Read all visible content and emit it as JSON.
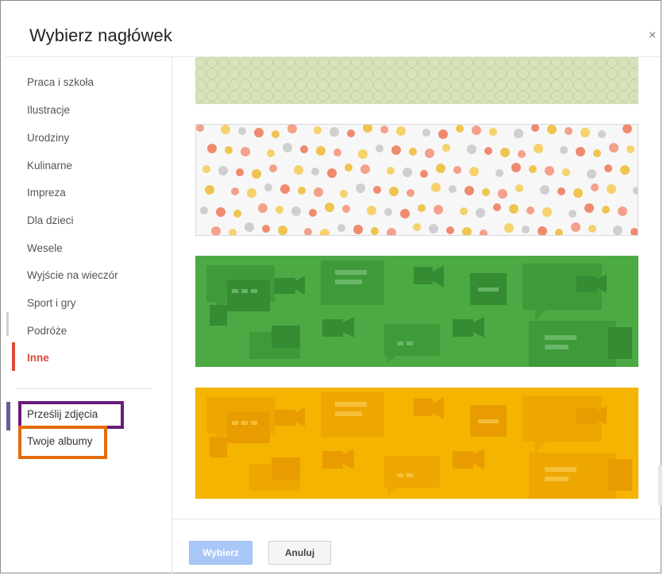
{
  "dialog": {
    "title": "Wybierz nagłówek",
    "close_label": "×"
  },
  "sidebar": {
    "categories": [
      {
        "label": "Praca i szkoła"
      },
      {
        "label": "Ilustracje"
      },
      {
        "label": "Urodziny"
      },
      {
        "label": "Kulinarne"
      },
      {
        "label": "Impreza"
      },
      {
        "label": "Dla dzieci"
      },
      {
        "label": "Wesele"
      },
      {
        "label": "Wyjście na wieczór"
      },
      {
        "label": "Sport i gry"
      },
      {
        "label": "Podróże"
      },
      {
        "label": "Inne"
      }
    ],
    "active_category": "Inne",
    "links": [
      {
        "label": "Prześlij zdjęcia"
      },
      {
        "label": "Twoje albumy"
      }
    ]
  },
  "banners": [
    {
      "name": "geometric-green"
    },
    {
      "name": "polka-dots"
    },
    {
      "name": "chat-icons-green"
    },
    {
      "name": "chat-icons-yellow"
    }
  ],
  "footer": {
    "select_label": "Wybierz",
    "cancel_label": "Anuluj"
  },
  "colors": {
    "accent_active": "#dd4b39",
    "highlight_purple": "#6a1b7a",
    "highlight_orange": "#e56b0a",
    "banner_green": "#4caa45",
    "banner_yellow": "#f4b400",
    "primary_button": "#a9c8f8"
  }
}
